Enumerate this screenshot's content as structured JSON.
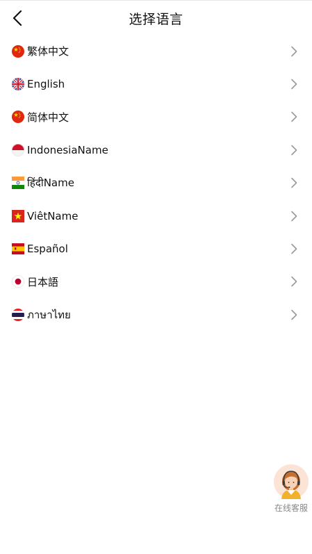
{
  "header": {
    "title": "选择语言"
  },
  "languages": [
    {
      "label": "繁体中文",
      "flag": "china-flag-icon"
    },
    {
      "label": "English",
      "flag": "uk-flag-icon"
    },
    {
      "label": "简体中文",
      "flag": "china-flag-icon"
    },
    {
      "label": "IndonesiaName",
      "flag": "indonesia-flag-icon"
    },
    {
      "label": "हिंदीName",
      "flag": "india-flag-icon"
    },
    {
      "label": "ViêtName",
      "flag": "vietnam-flag-icon"
    },
    {
      "label": "Español",
      "flag": "spain-flag-icon"
    },
    {
      "label": "日本語",
      "flag": "japan-flag-icon"
    },
    {
      "label": "ภาษาไทย",
      "flag": "thailand-flag-icon"
    }
  ],
  "customer_service": {
    "label": "在线客服",
    "icon": "customer-service-agent-icon"
  },
  "colors": {
    "text": "#111111",
    "chevron": "#9a9a9a",
    "service_text": "#888888"
  }
}
